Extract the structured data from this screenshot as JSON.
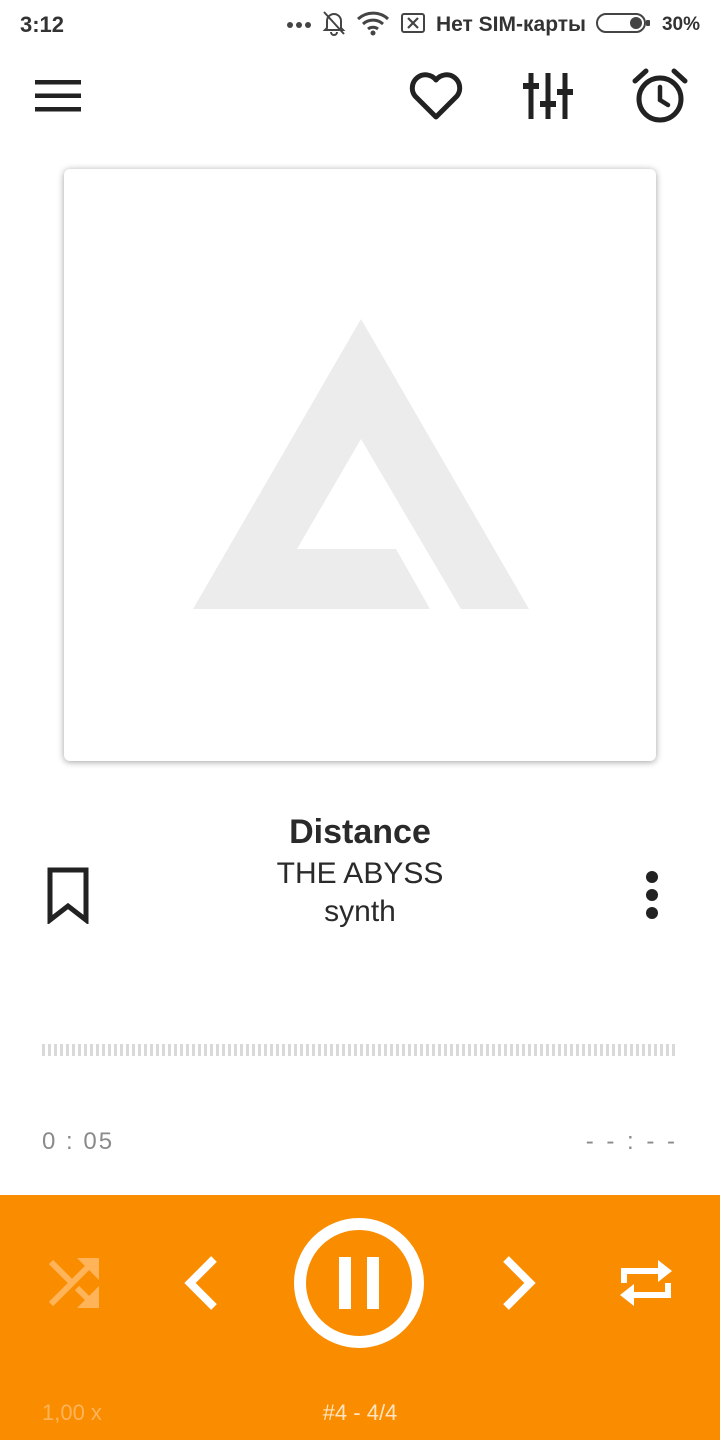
{
  "status_bar": {
    "time": "3:12",
    "carrier": "Нет SIM-карты",
    "battery": "30%",
    "icons": [
      "more-dots-icon",
      "bell-off-icon",
      "wifi-icon",
      "no-sim-icon",
      "battery-icon"
    ]
  },
  "toolbar": {
    "icons": [
      "menu-icon",
      "heart-icon",
      "equalizer-icon",
      "alarm-icon"
    ]
  },
  "track": {
    "title": "Distance",
    "artist": "THE ABYSS",
    "genre": "synth"
  },
  "player": {
    "elapsed": "0 : 05",
    "total": "- - : - -",
    "speed": "1,00 x",
    "queue_position": "#4 - 4/4"
  },
  "colors": {
    "accent": "#fa8c00",
    "controls_foreground": "#ffffff",
    "disabled_control": "#ffb45a",
    "placeholder_logo": "#ececec"
  }
}
